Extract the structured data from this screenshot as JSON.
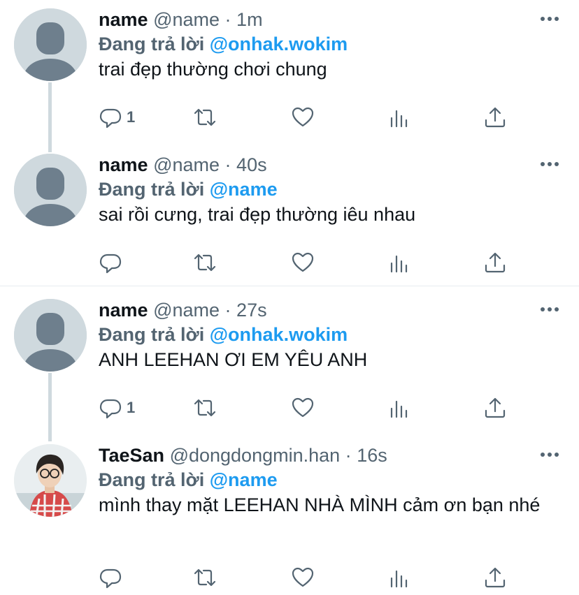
{
  "tweets": [
    {
      "name": "name",
      "handle": "@name",
      "dot": "·",
      "time": "1m",
      "reply_prefix": "Đang trả lời",
      "reply_to": "@onhak.wokim",
      "text": "trai đẹp thường chơi chung",
      "reply_count": "1",
      "avatar": "default-avatar"
    },
    {
      "name": "name",
      "handle": "@name",
      "dot": "·",
      "time": "40s",
      "reply_prefix": "Đang trả lời",
      "reply_to": "@name",
      "text": "sai rồi cưng, trai đẹp thường iêu nhau",
      "reply_count": "",
      "avatar": "default-avatar"
    },
    {
      "name": "name",
      "handle": "@name",
      "dot": "·",
      "time": "27s",
      "reply_prefix": "Đang trả lời",
      "reply_to": "@onhak.wokim",
      "text": "ANH LEEHAN ƠI EM YÊU ANH",
      "reply_count": "1",
      "avatar": "default-avatar"
    },
    {
      "name": "TaeSan",
      "handle": "@dongdongmin.han",
      "dot": "·",
      "time": "16s",
      "reply_prefix": "Đang trả lời",
      "reply_to": "@name",
      "text": "mình thay mặt LEEHAN NHÀ MÌNH cảm ơn bạn nhé",
      "reply_count": "",
      "avatar": "photo-avatar"
    }
  ],
  "colors": {
    "accent": "#1d9bf0",
    "secondary_text": "#536471",
    "primary_text": "#0f1419",
    "avatar_bg": "#cfd9de",
    "avatar_figure": "#6e7f8d"
  },
  "icons": [
    "reply-icon",
    "retweet-icon",
    "like-icon",
    "analytics-icon",
    "share-icon",
    "more-icon"
  ]
}
